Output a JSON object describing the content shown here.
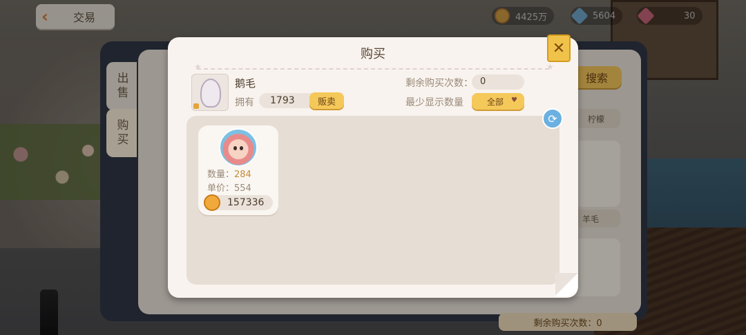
{
  "header": {
    "back_label": "交易",
    "coins": "4425万",
    "gems_blue": "5604",
    "gems_pink": "30"
  },
  "trade_panel": {
    "tab_sell": "出售",
    "tab_buy": "购买",
    "search_label": "搜索",
    "lemon_label": "柠檬",
    "wool_label": "羊毛",
    "bottom_remain": "剩余购买次数：0"
  },
  "dialog": {
    "title": "购买",
    "item_name": "鹅毛",
    "own_label": "拥有",
    "own_count": "1793",
    "sell_label": "贩卖",
    "remain_label": "剩余购买次数：",
    "remain_count": "0",
    "min_label": "最少显示数量",
    "min_value": "全部"
  },
  "listings": [
    {
      "qty_label": "数量：",
      "qty": "284",
      "price_label": "单价：",
      "price": "554",
      "total": "157336"
    }
  ],
  "icons": {
    "close": "close-icon",
    "refresh": "refresh-icon",
    "coin": "coin-icon",
    "heart": "heart-icon"
  },
  "colors": {
    "accent": "#f5c85a",
    "quantity": "#c68a3a",
    "refresh": "#6ab0e0"
  }
}
